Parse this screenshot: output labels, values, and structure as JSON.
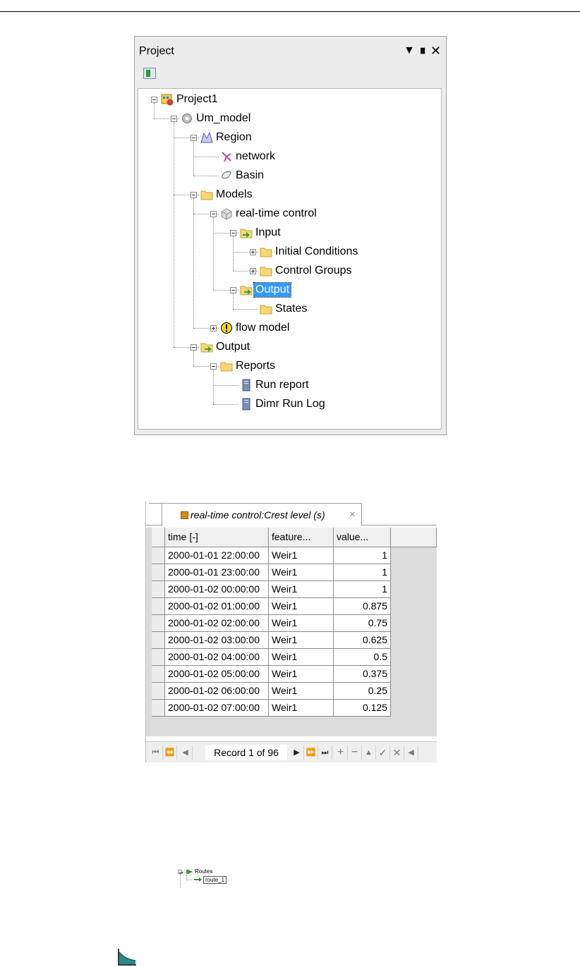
{
  "project_panel": {
    "title": "Project",
    "menu_icon": "dropdown-triangle-icon",
    "pin_icon": "pin-icon",
    "close_icon": "close-icon",
    "toolbar_icon": "link-with-document-icon",
    "tree": [
      {
        "label": "Project1",
        "icon": "project-icon",
        "toggle": "minus"
      },
      {
        "label": "Um_model",
        "icon": "gear-icon",
        "toggle": "minus"
      },
      {
        "label": "Region",
        "icon": "region-icon",
        "toggle": "minus"
      },
      {
        "label": "network",
        "icon": "network-icon",
        "toggle": ""
      },
      {
        "label": "Basin",
        "icon": "basin-icon",
        "toggle": ""
      },
      {
        "label": "Models",
        "icon": "folder-icon",
        "toggle": "minus"
      },
      {
        "label": "real-time control",
        "icon": "rtc-model-icon",
        "toggle": "minus"
      },
      {
        "label": "Input",
        "icon": "input-folder-icon",
        "toggle": "minus"
      },
      {
        "label": "Initial Conditions",
        "icon": "folder-icon",
        "toggle": "plus"
      },
      {
        "label": "Control Groups",
        "icon": "folder-icon",
        "toggle": "plus"
      },
      {
        "label": "Output",
        "icon": "output-folder-icon",
        "toggle": "minus",
        "selected": true
      },
      {
        "label": "States",
        "icon": "folder-icon",
        "toggle": ""
      },
      {
        "label": "flow model",
        "icon": "warning-icon",
        "toggle": "plus"
      },
      {
        "label": "Output",
        "icon": "output-folder-icon",
        "toggle": "minus"
      },
      {
        "label": "Reports",
        "icon": "folder-icon",
        "toggle": "minus"
      },
      {
        "label": "Run report",
        "icon": "report-icon",
        "toggle": ""
      },
      {
        "label": "Dimr Run Log",
        "icon": "report-icon",
        "toggle": ""
      }
    ]
  },
  "table_window": {
    "tab_title": "real-time control:Crest level (s)",
    "tab_icon": "rtc-model-icon",
    "tab_close": "×",
    "columns": [
      "time [-]",
      "feature...",
      "value..."
    ],
    "rows": [
      [
        "2000-01-01 22:00:00",
        "Weir1",
        "1"
      ],
      [
        "2000-01-01 23:00:00",
        "Weir1",
        "1"
      ],
      [
        "2000-01-02 00:00:00",
        "Weir1",
        "1"
      ],
      [
        "2000-01-02 01:00:00",
        "Weir1",
        "0.875"
      ],
      [
        "2000-01-02 02:00:00",
        "Weir1",
        "0.75"
      ],
      [
        "2000-01-02 03:00:00",
        "Weir1",
        "0.625"
      ],
      [
        "2000-01-02 04:00:00",
        "Weir1",
        "0.5"
      ],
      [
        "2000-01-02 05:00:00",
        "Weir1",
        "0.375"
      ],
      [
        "2000-01-02 06:00:00",
        "Weir1",
        "0.25"
      ],
      [
        "2000-01-02 07:00:00",
        "Weir1",
        "0.125"
      ]
    ],
    "record_text": "Record 1 of 96"
  },
  "routes_snippet": {
    "parent": "Routes",
    "child": "route_1",
    "icons": [
      "routes-icon",
      "route-arrow-icon"
    ]
  },
  "chart_icon": "area-chart-icon"
}
